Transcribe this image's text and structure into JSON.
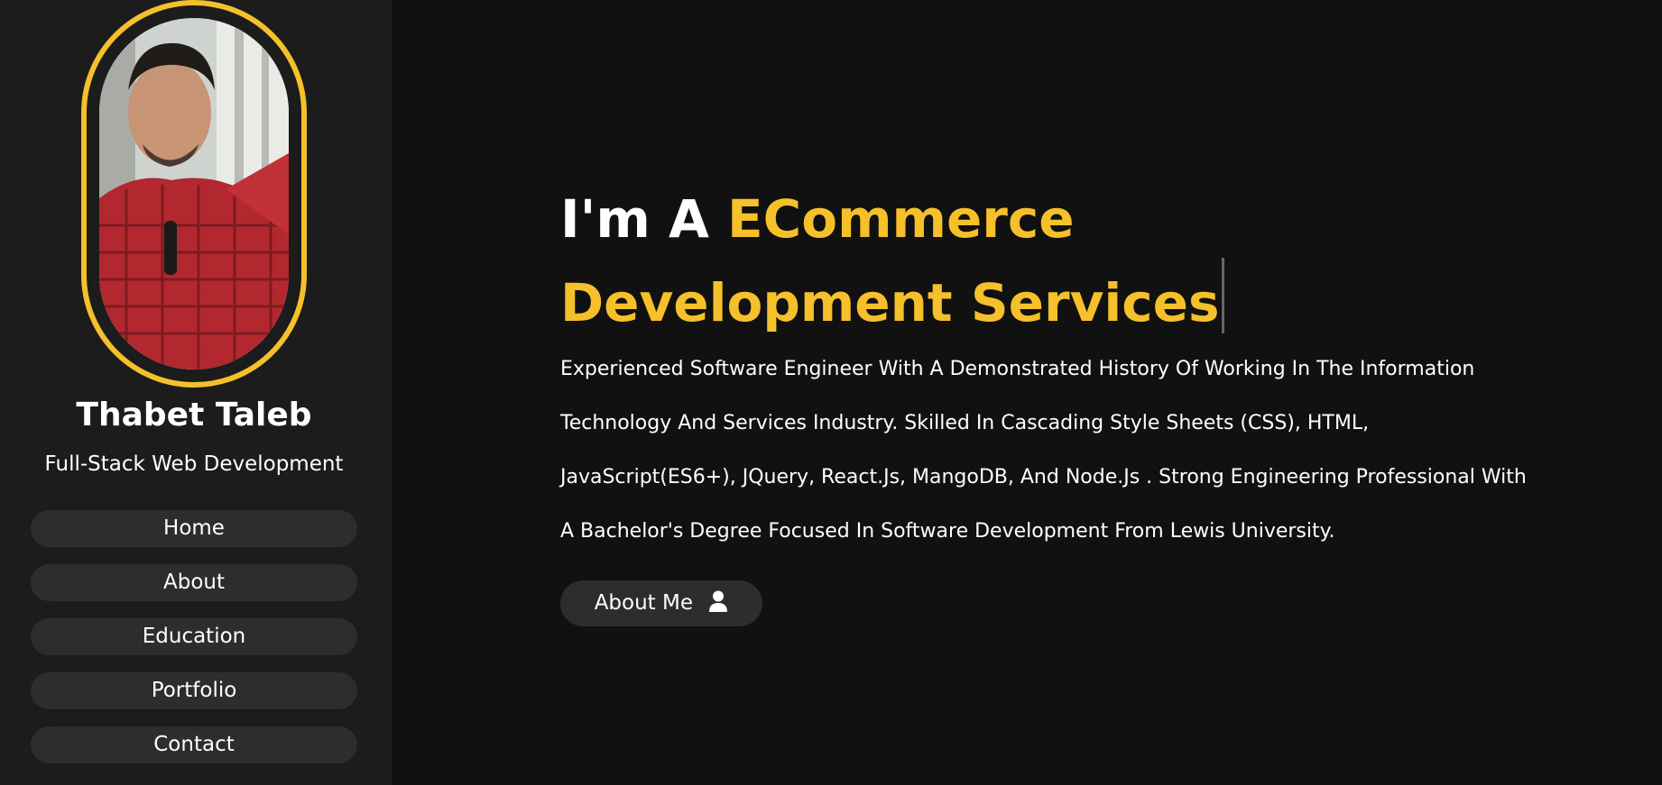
{
  "profile": {
    "name": "Thabet Taleb",
    "title": "Full-Stack Web Development",
    "avatar_icon": "profile-photo"
  },
  "nav": {
    "items": [
      {
        "label": "Home"
      },
      {
        "label": "About"
      },
      {
        "label": "Education"
      },
      {
        "label": "Portfolio"
      },
      {
        "label": "Contact"
      }
    ]
  },
  "hero": {
    "prefix": "I'm A ",
    "highlight": "ECommerce Development Services",
    "bio": "Experienced Software Engineer With A Demonstrated History Of Working In The Information Technology And Services Industry. Skilled In Cascading Style Sheets (CSS), HTML, JavaScript(ES6+), JQuery, React.Js, MangoDB, And Node.Js . Strong Engineering Professional With A Bachelor's Degree Focused In Software Development From Lewis University.",
    "button_label": "About Me",
    "button_icon": "user-icon"
  },
  "colors": {
    "accent": "#f5c02a",
    "background": "#111111",
    "sidebar": "#1c1c1c",
    "button": "#2d2d2d"
  }
}
